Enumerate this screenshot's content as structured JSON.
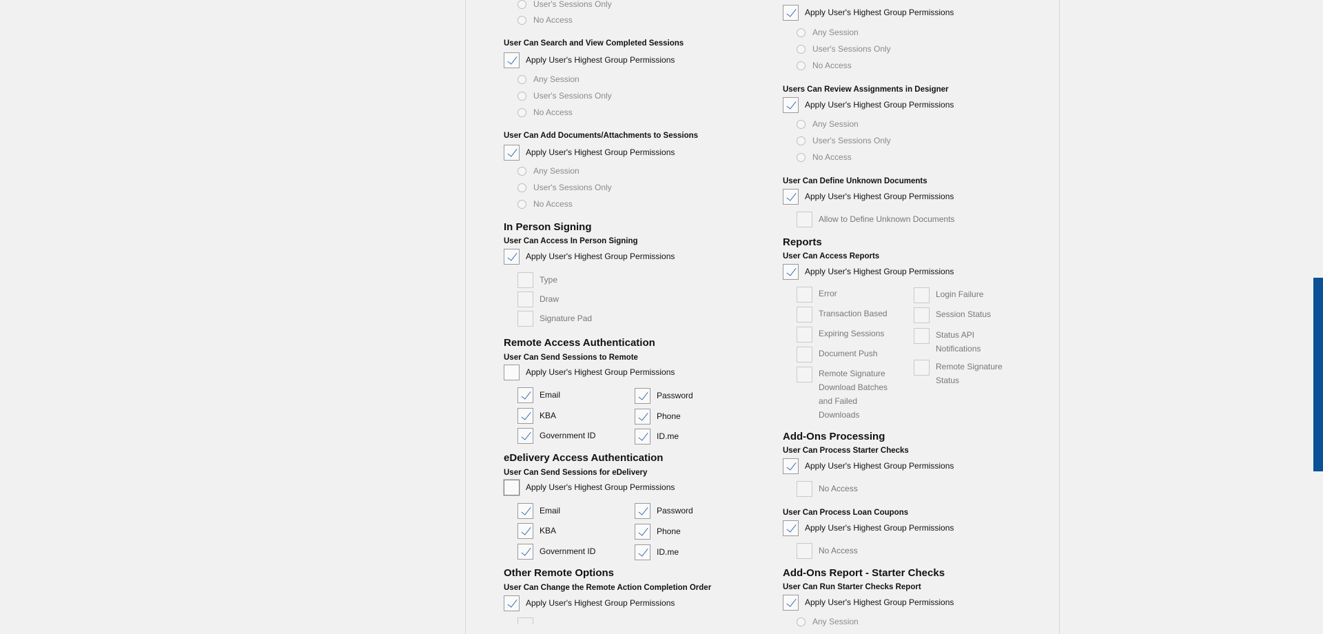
{
  "left": {
    "top_radios": [
      "User's Sessions Only",
      "No Access"
    ],
    "search_view": {
      "title": "User Can Search and View Completed Sessions",
      "apply": "Apply User's Highest Group Permissions",
      "options": [
        "Any Session",
        "User's Sessions Only",
        "No Access"
      ]
    },
    "add_docs": {
      "title": "User Can Add Documents/Attachments to Sessions",
      "apply": "Apply User's Highest Group Permissions",
      "options": [
        "Any Session",
        "User's Sessions Only",
        "No Access"
      ]
    },
    "in_person": {
      "section": "In Person Signing",
      "title": "User Can Access In Person Signing",
      "apply": "Apply User's Highest Group Permissions",
      "options": [
        "Type",
        "Draw",
        "Signature Pad"
      ]
    },
    "remote_auth": {
      "section": "Remote Access Authentication",
      "title": "User Can Send Sessions to Remote",
      "apply": "Apply User's Highest Group Permissions",
      "options_left": [
        "Email",
        "KBA",
        "Government ID"
      ],
      "options_right": [
        "Password",
        "Phone",
        "ID.me"
      ]
    },
    "edelivery_auth": {
      "section": "eDelivery Access Authentication",
      "title": "User Can Send Sessions for eDelivery",
      "apply": "Apply User's Highest Group Permissions",
      "options_left": [
        "Email",
        "KBA",
        "Government ID"
      ],
      "options_right": [
        "Password",
        "Phone",
        "ID.me"
      ]
    },
    "other_remote": {
      "section": "Other Remote Options",
      "title": "User Can Change the Remote Action Completion Order",
      "apply": "Apply User's Highest Group Permissions"
    }
  },
  "right": {
    "designer_app": {
      "apply": "Apply User's Highest Group Permissions",
      "options": [
        "Any Session",
        "User's Sessions Only",
        "No Access"
      ]
    },
    "review_assign": {
      "title": "Users Can Review Assignments in Designer",
      "apply": "Apply User's Highest Group Permissions",
      "options": [
        "Any Session",
        "User's Sessions Only",
        "No Access"
      ]
    },
    "define_unknown": {
      "title": "User Can Define Unknown Documents",
      "apply": "Apply User's Highest Group Permissions",
      "option": "Allow to Define Unknown Documents"
    },
    "reports": {
      "section": "Reports",
      "title": "User Can Access Reports",
      "apply": "Apply User's Highest Group Permissions",
      "options_left": [
        "Error",
        "Transaction Based",
        "Expiring Sessions",
        "Document Push",
        "Remote Signature Download Batches and Failed Downloads"
      ],
      "options_right": [
        "Login Failure",
        "Session Status",
        "Status API Notifications",
        "Remote Signature Status"
      ]
    },
    "addons_processing": {
      "section": "Add-Ons Processing",
      "starter_title": "User Can Process Starter Checks",
      "starter_apply": "Apply User's Highest Group Permissions",
      "starter_option": "No Access",
      "loan_title": "User Can Process Loan Coupons",
      "loan_apply": "Apply User's Highest Group Permissions",
      "loan_option": "No Access"
    },
    "addons_report": {
      "section": "Add-Ons Report - Starter Checks",
      "title": "User Can Run Starter Checks Report",
      "apply": "Apply User's Highest Group Permissions",
      "partial_option": "Any Session"
    }
  }
}
